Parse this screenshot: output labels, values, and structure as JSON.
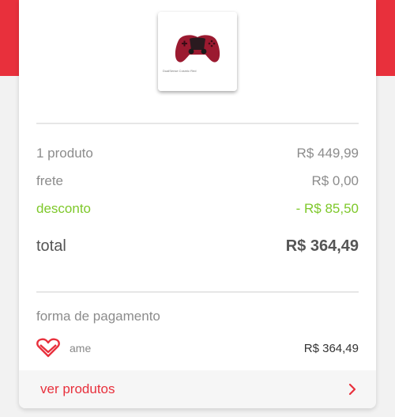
{
  "product": {
    "thumbnail_caption": "DualSense Cosmic Red",
    "thumbnail_icon": "gamepad-image"
  },
  "summary": {
    "items": {
      "label": "1 produto",
      "value": "R$ 449,99"
    },
    "shipping": {
      "label": "frete",
      "value": "R$ 0,00"
    },
    "discount": {
      "label": "desconto",
      "value": "- R$ 85,50"
    },
    "total": {
      "label": "total",
      "value": "R$ 364,49"
    }
  },
  "payment": {
    "title": "forma de pagamento",
    "method_name": "ame",
    "method_icon": "ame-heart-icon",
    "amount": "R$ 364,49"
  },
  "footer": {
    "label": "ver produtos",
    "icon": "chevron-right-icon"
  },
  "colors": {
    "brand_red": "#e8303c",
    "discount_green": "#7ec82a",
    "muted_text": "#8c8c8c"
  }
}
